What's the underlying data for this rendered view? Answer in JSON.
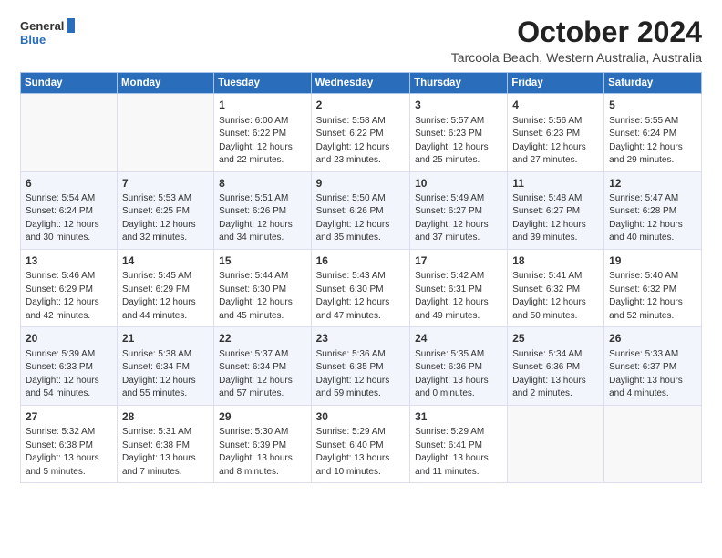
{
  "header": {
    "logo_general": "General",
    "logo_blue": "Blue",
    "month_title": "October 2024",
    "location": "Tarcoola Beach, Western Australia, Australia"
  },
  "days_of_week": [
    "Sunday",
    "Monday",
    "Tuesday",
    "Wednesday",
    "Thursday",
    "Friday",
    "Saturday"
  ],
  "weeks": [
    [
      {
        "day": "",
        "detail": ""
      },
      {
        "day": "",
        "detail": ""
      },
      {
        "day": "1",
        "detail": "Sunrise: 6:00 AM\nSunset: 6:22 PM\nDaylight: 12 hours\nand 22 minutes."
      },
      {
        "day": "2",
        "detail": "Sunrise: 5:58 AM\nSunset: 6:22 PM\nDaylight: 12 hours\nand 23 minutes."
      },
      {
        "day": "3",
        "detail": "Sunrise: 5:57 AM\nSunset: 6:23 PM\nDaylight: 12 hours\nand 25 minutes."
      },
      {
        "day": "4",
        "detail": "Sunrise: 5:56 AM\nSunset: 6:23 PM\nDaylight: 12 hours\nand 27 minutes."
      },
      {
        "day": "5",
        "detail": "Sunrise: 5:55 AM\nSunset: 6:24 PM\nDaylight: 12 hours\nand 29 minutes."
      }
    ],
    [
      {
        "day": "6",
        "detail": "Sunrise: 5:54 AM\nSunset: 6:24 PM\nDaylight: 12 hours\nand 30 minutes."
      },
      {
        "day": "7",
        "detail": "Sunrise: 5:53 AM\nSunset: 6:25 PM\nDaylight: 12 hours\nand 32 minutes."
      },
      {
        "day": "8",
        "detail": "Sunrise: 5:51 AM\nSunset: 6:26 PM\nDaylight: 12 hours\nand 34 minutes."
      },
      {
        "day": "9",
        "detail": "Sunrise: 5:50 AM\nSunset: 6:26 PM\nDaylight: 12 hours\nand 35 minutes."
      },
      {
        "day": "10",
        "detail": "Sunrise: 5:49 AM\nSunset: 6:27 PM\nDaylight: 12 hours\nand 37 minutes."
      },
      {
        "day": "11",
        "detail": "Sunrise: 5:48 AM\nSunset: 6:27 PM\nDaylight: 12 hours\nand 39 minutes."
      },
      {
        "day": "12",
        "detail": "Sunrise: 5:47 AM\nSunset: 6:28 PM\nDaylight: 12 hours\nand 40 minutes."
      }
    ],
    [
      {
        "day": "13",
        "detail": "Sunrise: 5:46 AM\nSunset: 6:29 PM\nDaylight: 12 hours\nand 42 minutes."
      },
      {
        "day": "14",
        "detail": "Sunrise: 5:45 AM\nSunset: 6:29 PM\nDaylight: 12 hours\nand 44 minutes."
      },
      {
        "day": "15",
        "detail": "Sunrise: 5:44 AM\nSunset: 6:30 PM\nDaylight: 12 hours\nand 45 minutes."
      },
      {
        "day": "16",
        "detail": "Sunrise: 5:43 AM\nSunset: 6:30 PM\nDaylight: 12 hours\nand 47 minutes."
      },
      {
        "day": "17",
        "detail": "Sunrise: 5:42 AM\nSunset: 6:31 PM\nDaylight: 12 hours\nand 49 minutes."
      },
      {
        "day": "18",
        "detail": "Sunrise: 5:41 AM\nSunset: 6:32 PM\nDaylight: 12 hours\nand 50 minutes."
      },
      {
        "day": "19",
        "detail": "Sunrise: 5:40 AM\nSunset: 6:32 PM\nDaylight: 12 hours\nand 52 minutes."
      }
    ],
    [
      {
        "day": "20",
        "detail": "Sunrise: 5:39 AM\nSunset: 6:33 PM\nDaylight: 12 hours\nand 54 minutes."
      },
      {
        "day": "21",
        "detail": "Sunrise: 5:38 AM\nSunset: 6:34 PM\nDaylight: 12 hours\nand 55 minutes."
      },
      {
        "day": "22",
        "detail": "Sunrise: 5:37 AM\nSunset: 6:34 PM\nDaylight: 12 hours\nand 57 minutes."
      },
      {
        "day": "23",
        "detail": "Sunrise: 5:36 AM\nSunset: 6:35 PM\nDaylight: 12 hours\nand 59 minutes."
      },
      {
        "day": "24",
        "detail": "Sunrise: 5:35 AM\nSunset: 6:36 PM\nDaylight: 13 hours\nand 0 minutes."
      },
      {
        "day": "25",
        "detail": "Sunrise: 5:34 AM\nSunset: 6:36 PM\nDaylight: 13 hours\nand 2 minutes."
      },
      {
        "day": "26",
        "detail": "Sunrise: 5:33 AM\nSunset: 6:37 PM\nDaylight: 13 hours\nand 4 minutes."
      }
    ],
    [
      {
        "day": "27",
        "detail": "Sunrise: 5:32 AM\nSunset: 6:38 PM\nDaylight: 13 hours\nand 5 minutes."
      },
      {
        "day": "28",
        "detail": "Sunrise: 5:31 AM\nSunset: 6:38 PM\nDaylight: 13 hours\nand 7 minutes."
      },
      {
        "day": "29",
        "detail": "Sunrise: 5:30 AM\nSunset: 6:39 PM\nDaylight: 13 hours\nand 8 minutes."
      },
      {
        "day": "30",
        "detail": "Sunrise: 5:29 AM\nSunset: 6:40 PM\nDaylight: 13 hours\nand 10 minutes."
      },
      {
        "day": "31",
        "detail": "Sunrise: 5:29 AM\nSunset: 6:41 PM\nDaylight: 13 hours\nand 11 minutes."
      },
      {
        "day": "",
        "detail": ""
      },
      {
        "day": "",
        "detail": ""
      }
    ]
  ]
}
